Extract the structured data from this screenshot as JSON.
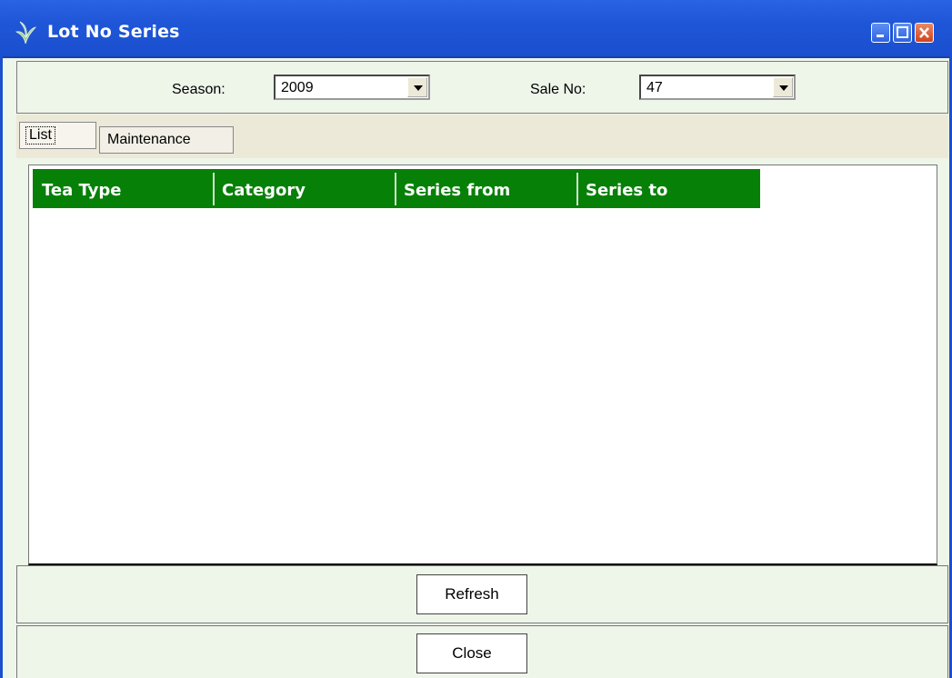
{
  "window": {
    "title": "Lot No Series",
    "app_icon": "tea-leaf-icon",
    "controls": [
      "minimize-icon",
      "maximize-icon",
      "close-icon"
    ]
  },
  "filters": {
    "season_label": "Season:",
    "season_value": "2009",
    "sale_label": "Sale No:",
    "sale_value": "47"
  },
  "tabs": [
    {
      "label": "List",
      "active": true
    },
    {
      "label": "Maintenance",
      "active": false
    }
  ],
  "grid": {
    "columns": [
      "Tea Type",
      "Category",
      "Series from",
      "Series to"
    ],
    "header_color": "#078007",
    "rows": []
  },
  "buttons": {
    "refresh_label": "Refresh",
    "close_label": "Close"
  }
}
